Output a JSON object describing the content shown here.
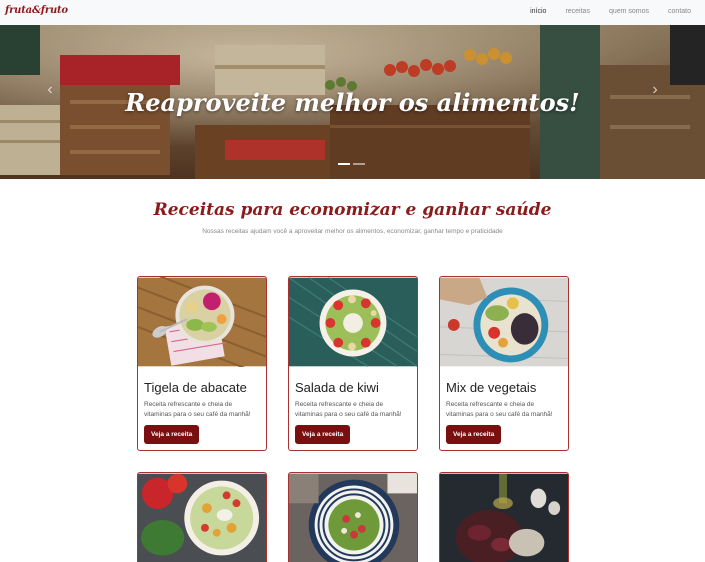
{
  "navbar": {
    "brand": "fruta&fruto",
    "links": [
      "início",
      "receitas",
      "quem somos",
      "contato"
    ]
  },
  "hero": {
    "title": "Reaproveite melhor os alimentos!",
    "prev_icon": "chevron-left-icon",
    "next_icon": "chevron-right-icon"
  },
  "section": {
    "title": "Receitas para economizar e ganhar saúde",
    "subtitle": "Nossas receitas ajudam você a aproveitar melhor os alimentos, economizar, ganhar tempo e praticidade"
  },
  "cards": [
    {
      "title": "Tigela de abacate",
      "text": "Receita refrescante e cheia de vitaminas para o seu café da manhã!",
      "button": "Veja a receita"
    },
    {
      "title": "Salada de kiwi",
      "text": "Receita refrescante e cheia de vitaminas para o seu café da manhã!",
      "button": "Veja a receita"
    },
    {
      "title": "Mix de vegetais",
      "text": "Receita refrescante e cheia de vitaminas para o seu café da manhã!",
      "button": "Veja a receita"
    }
  ],
  "colors": {
    "brand": "#8b1a1a",
    "button": "#7a0f0f",
    "card_border": "#a83232"
  }
}
